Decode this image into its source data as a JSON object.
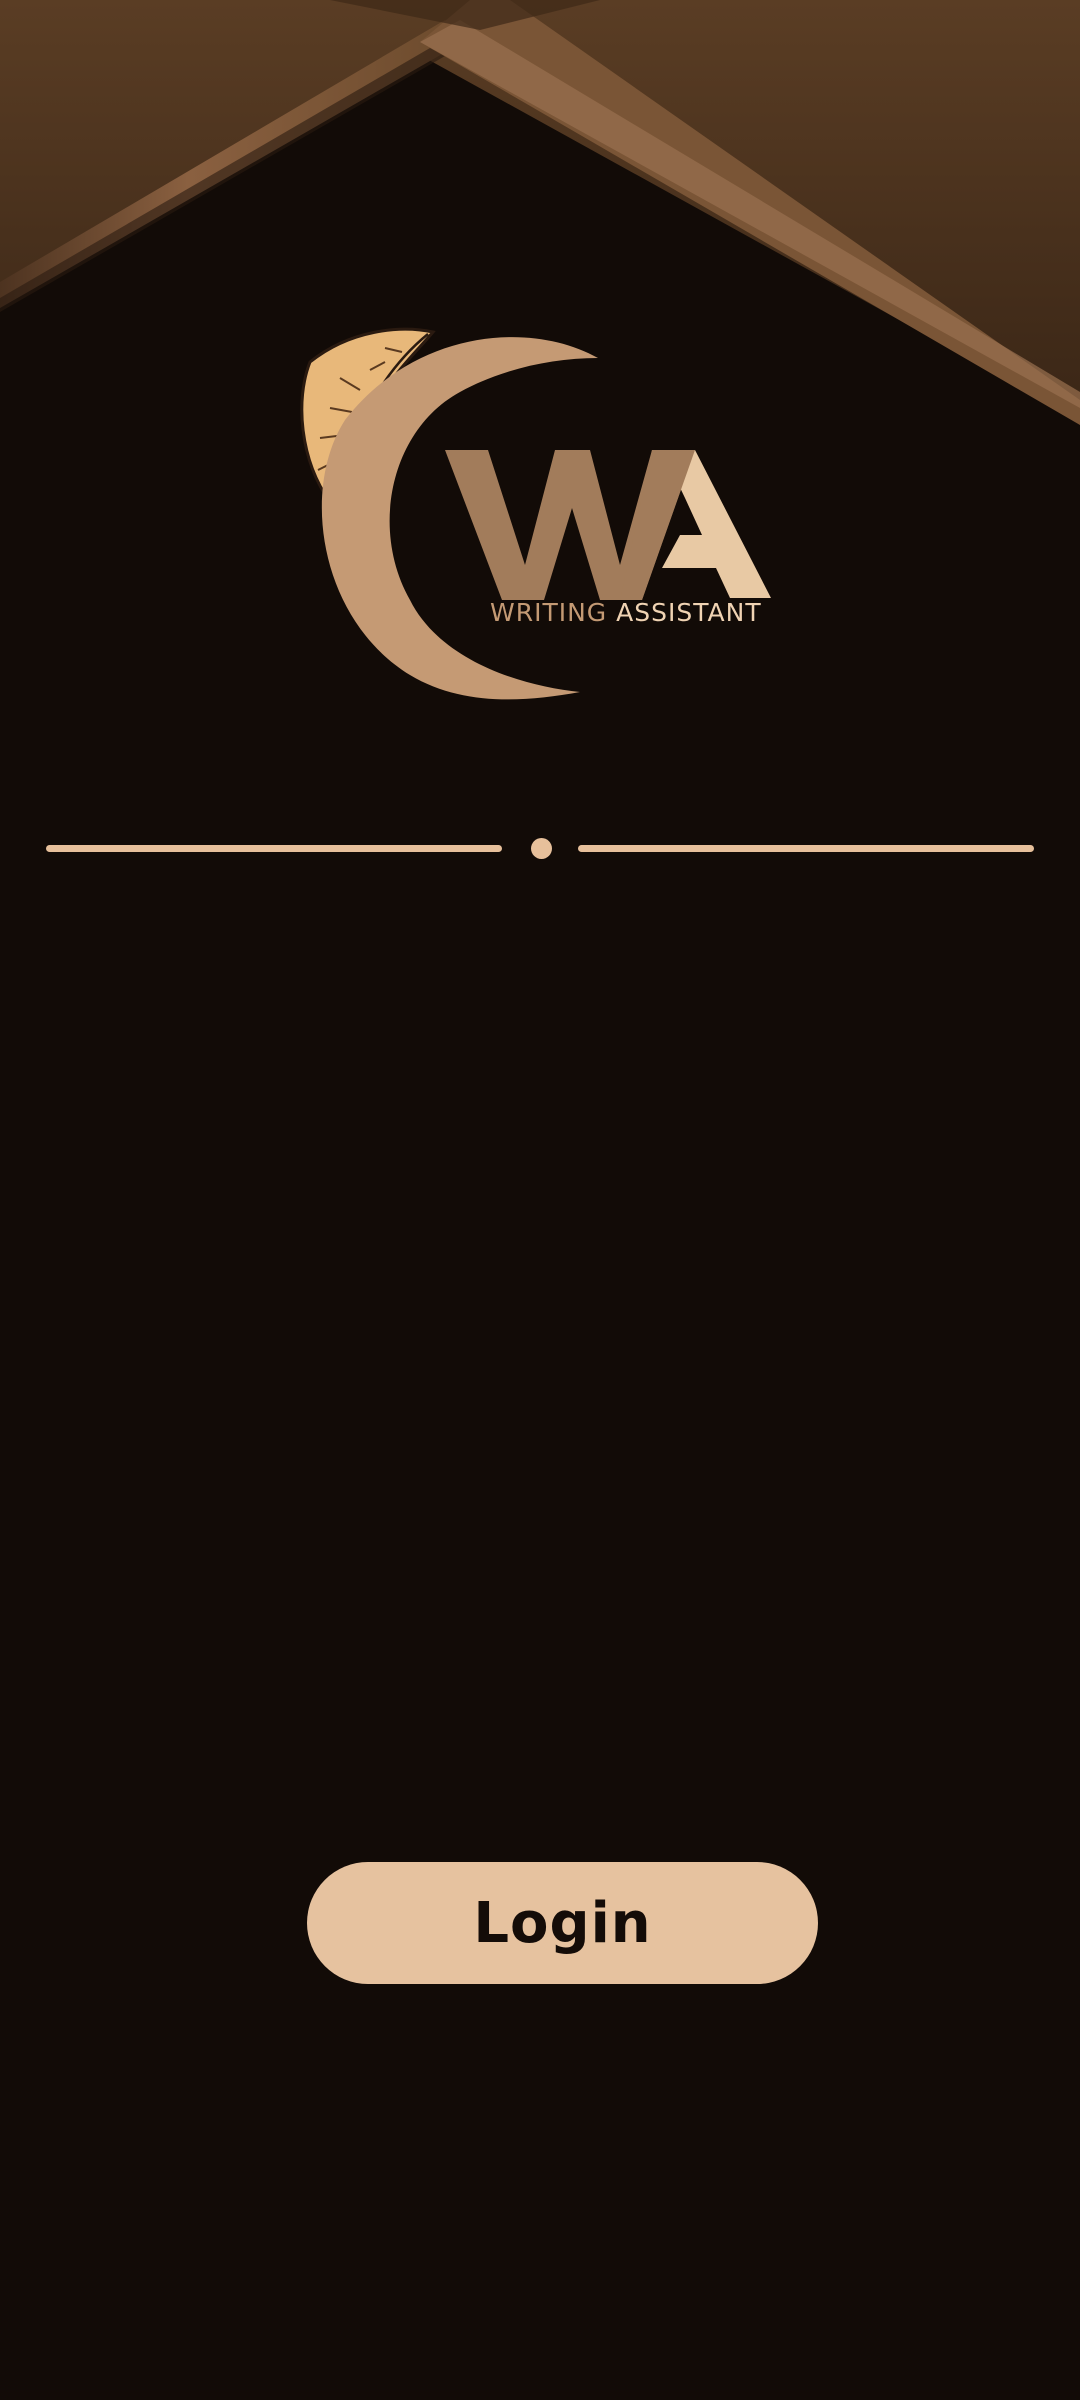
{
  "logo": {
    "monogram": "WA",
    "wordmark_part1": "WRITING",
    "wordmark_part2": "ASSISTANT",
    "icons": [
      "leaf-icon",
      "crescent-moon-icon"
    ]
  },
  "login": {
    "label": "Login"
  },
  "colors": {
    "background": "#120b07",
    "accent": "#e6c29f",
    "roof_brown": "#6b4a2c",
    "monogram_w": "#a07a59",
    "monogram_a": "#e8c9a4"
  }
}
